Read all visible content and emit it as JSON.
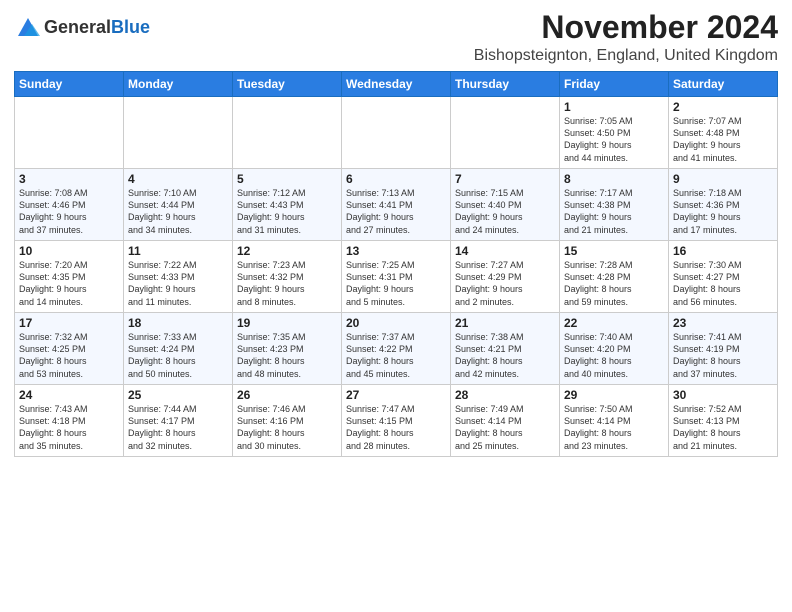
{
  "logo": {
    "general": "General",
    "blue": "Blue"
  },
  "title": "November 2024",
  "location": "Bishopsteignton, England, United Kingdom",
  "header": {
    "days": [
      "Sunday",
      "Monday",
      "Tuesday",
      "Wednesday",
      "Thursday",
      "Friday",
      "Saturday"
    ]
  },
  "weeks": [
    [
      {
        "day": "",
        "info": ""
      },
      {
        "day": "",
        "info": ""
      },
      {
        "day": "",
        "info": ""
      },
      {
        "day": "",
        "info": ""
      },
      {
        "day": "",
        "info": ""
      },
      {
        "day": "1",
        "info": "Sunrise: 7:05 AM\nSunset: 4:50 PM\nDaylight: 9 hours\nand 44 minutes."
      },
      {
        "day": "2",
        "info": "Sunrise: 7:07 AM\nSunset: 4:48 PM\nDaylight: 9 hours\nand 41 minutes."
      }
    ],
    [
      {
        "day": "3",
        "info": "Sunrise: 7:08 AM\nSunset: 4:46 PM\nDaylight: 9 hours\nand 37 minutes."
      },
      {
        "day": "4",
        "info": "Sunrise: 7:10 AM\nSunset: 4:44 PM\nDaylight: 9 hours\nand 34 minutes."
      },
      {
        "day": "5",
        "info": "Sunrise: 7:12 AM\nSunset: 4:43 PM\nDaylight: 9 hours\nand 31 minutes."
      },
      {
        "day": "6",
        "info": "Sunrise: 7:13 AM\nSunset: 4:41 PM\nDaylight: 9 hours\nand 27 minutes."
      },
      {
        "day": "7",
        "info": "Sunrise: 7:15 AM\nSunset: 4:40 PM\nDaylight: 9 hours\nand 24 minutes."
      },
      {
        "day": "8",
        "info": "Sunrise: 7:17 AM\nSunset: 4:38 PM\nDaylight: 9 hours\nand 21 minutes."
      },
      {
        "day": "9",
        "info": "Sunrise: 7:18 AM\nSunset: 4:36 PM\nDaylight: 9 hours\nand 17 minutes."
      }
    ],
    [
      {
        "day": "10",
        "info": "Sunrise: 7:20 AM\nSunset: 4:35 PM\nDaylight: 9 hours\nand 14 minutes."
      },
      {
        "day": "11",
        "info": "Sunrise: 7:22 AM\nSunset: 4:33 PM\nDaylight: 9 hours\nand 11 minutes."
      },
      {
        "day": "12",
        "info": "Sunrise: 7:23 AM\nSunset: 4:32 PM\nDaylight: 9 hours\nand 8 minutes."
      },
      {
        "day": "13",
        "info": "Sunrise: 7:25 AM\nSunset: 4:31 PM\nDaylight: 9 hours\nand 5 minutes."
      },
      {
        "day": "14",
        "info": "Sunrise: 7:27 AM\nSunset: 4:29 PM\nDaylight: 9 hours\nand 2 minutes."
      },
      {
        "day": "15",
        "info": "Sunrise: 7:28 AM\nSunset: 4:28 PM\nDaylight: 8 hours\nand 59 minutes."
      },
      {
        "day": "16",
        "info": "Sunrise: 7:30 AM\nSunset: 4:27 PM\nDaylight: 8 hours\nand 56 minutes."
      }
    ],
    [
      {
        "day": "17",
        "info": "Sunrise: 7:32 AM\nSunset: 4:25 PM\nDaylight: 8 hours\nand 53 minutes."
      },
      {
        "day": "18",
        "info": "Sunrise: 7:33 AM\nSunset: 4:24 PM\nDaylight: 8 hours\nand 50 minutes."
      },
      {
        "day": "19",
        "info": "Sunrise: 7:35 AM\nSunset: 4:23 PM\nDaylight: 8 hours\nand 48 minutes."
      },
      {
        "day": "20",
        "info": "Sunrise: 7:37 AM\nSunset: 4:22 PM\nDaylight: 8 hours\nand 45 minutes."
      },
      {
        "day": "21",
        "info": "Sunrise: 7:38 AM\nSunset: 4:21 PM\nDaylight: 8 hours\nand 42 minutes."
      },
      {
        "day": "22",
        "info": "Sunrise: 7:40 AM\nSunset: 4:20 PM\nDaylight: 8 hours\nand 40 minutes."
      },
      {
        "day": "23",
        "info": "Sunrise: 7:41 AM\nSunset: 4:19 PM\nDaylight: 8 hours\nand 37 minutes."
      }
    ],
    [
      {
        "day": "24",
        "info": "Sunrise: 7:43 AM\nSunset: 4:18 PM\nDaylight: 8 hours\nand 35 minutes."
      },
      {
        "day": "25",
        "info": "Sunrise: 7:44 AM\nSunset: 4:17 PM\nDaylight: 8 hours\nand 32 minutes."
      },
      {
        "day": "26",
        "info": "Sunrise: 7:46 AM\nSunset: 4:16 PM\nDaylight: 8 hours\nand 30 minutes."
      },
      {
        "day": "27",
        "info": "Sunrise: 7:47 AM\nSunset: 4:15 PM\nDaylight: 8 hours\nand 28 minutes."
      },
      {
        "day": "28",
        "info": "Sunrise: 7:49 AM\nSunset: 4:14 PM\nDaylight: 8 hours\nand 25 minutes."
      },
      {
        "day": "29",
        "info": "Sunrise: 7:50 AM\nSunset: 4:14 PM\nDaylight: 8 hours\nand 23 minutes."
      },
      {
        "day": "30",
        "info": "Sunrise: 7:52 AM\nSunset: 4:13 PM\nDaylight: 8 hours\nand 21 minutes."
      }
    ]
  ]
}
